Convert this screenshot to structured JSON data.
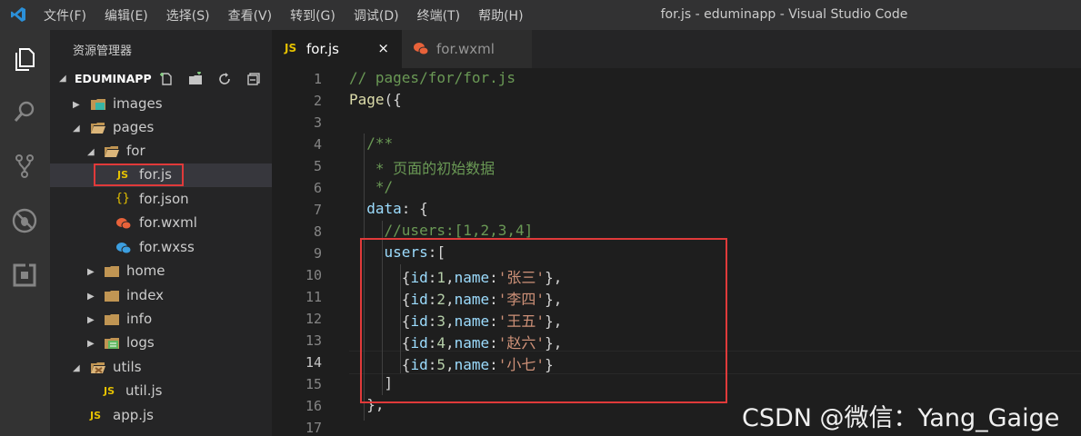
{
  "window": {
    "title": "for.js - eduminapp - Visual Studio Code"
  },
  "menu": [
    "文件(F)",
    "编辑(E)",
    "选择(S)",
    "查看(V)",
    "转到(G)",
    "调试(D)",
    "终端(T)",
    "帮助(H)"
  ],
  "activity_bar": [
    "files-icon",
    "search-icon",
    "source-control-icon",
    "debug-icon",
    "extensions-icon"
  ],
  "sidebar": {
    "title": "资源管理器",
    "section": "EDUMINAPP",
    "tools": [
      "new-file-icon",
      "new-folder-icon",
      "refresh-icon",
      "collapse-icon"
    ],
    "tree": [
      {
        "label": "images",
        "icon": "image-folder-icon",
        "type": "folder-collapsed"
      },
      {
        "label": "pages",
        "icon": "folder-open-icon",
        "type": "folder-expanded"
      },
      {
        "label": "for",
        "icon": "folder-open-icon",
        "type": "folder-expanded"
      },
      {
        "label": "for.js",
        "icon": "js-file-icon",
        "type": "file",
        "badge": "JS"
      },
      {
        "label": "for.json",
        "icon": "json-file-icon",
        "type": "file",
        "badge": "{}"
      },
      {
        "label": "for.wxml",
        "icon": "wechat-file-icon",
        "type": "file"
      },
      {
        "label": "for.wxss",
        "icon": "wechat-style-icon",
        "type": "file"
      },
      {
        "label": "home",
        "icon": "folder-icon",
        "type": "folder-collapsed"
      },
      {
        "label": "index",
        "icon": "folder-icon",
        "type": "folder-collapsed"
      },
      {
        "label": "info",
        "icon": "folder-icon",
        "type": "folder-collapsed"
      },
      {
        "label": "logs",
        "icon": "logs-folder-icon",
        "type": "folder-collapsed"
      },
      {
        "label": "utils",
        "icon": "utils-folder-icon",
        "type": "folder-expanded"
      },
      {
        "label": "util.js",
        "icon": "js-file-icon",
        "type": "file",
        "badge": "JS"
      },
      {
        "label": "app.js",
        "icon": "js-file-icon",
        "type": "file",
        "badge": "JS"
      }
    ]
  },
  "tabs": [
    {
      "label": "for.js",
      "badge": "JS",
      "close": "×",
      "active": true
    },
    {
      "label": "for.wxml",
      "active": false
    }
  ],
  "editor": {
    "line_numbers": [
      "1",
      "2",
      "3",
      "4",
      "5",
      "6",
      "7",
      "8",
      "9",
      "10",
      "11",
      "12",
      "13",
      "14",
      "15",
      "16",
      "17"
    ],
    "lines": [
      {
        "text": "// pages/for/for.js"
      },
      {
        "text": "Page({"
      },
      {
        "text": ""
      },
      {
        "text": "  /**"
      },
      {
        "text": "   * 页面的初始数据"
      },
      {
        "text": "   */"
      },
      {
        "text": "  data: {"
      },
      {
        "text": "    //users:[1,2,3,4]"
      },
      {
        "text": "    users:["
      },
      {
        "text": "      {id:1,name:'张三'},"
      },
      {
        "text": "      {id:2,name:'李四'},"
      },
      {
        "text": "      {id:3,name:'王五'},"
      },
      {
        "text": "      {id:4,name:'赵六'},"
      },
      {
        "text": "      {id:5,name:'小七'}"
      },
      {
        "text": "    ]"
      },
      {
        "text": "  },"
      },
      {
        "text": ""
      }
    ],
    "active_line": "14"
  },
  "watermark": "CSDN @微信：Yang_Gaige",
  "colors": {
    "highlight_box": "#e03a3a",
    "comment": "#6a9955",
    "property": "#9cdcfe",
    "string": "#ce9178",
    "number": "#b5cea8"
  }
}
